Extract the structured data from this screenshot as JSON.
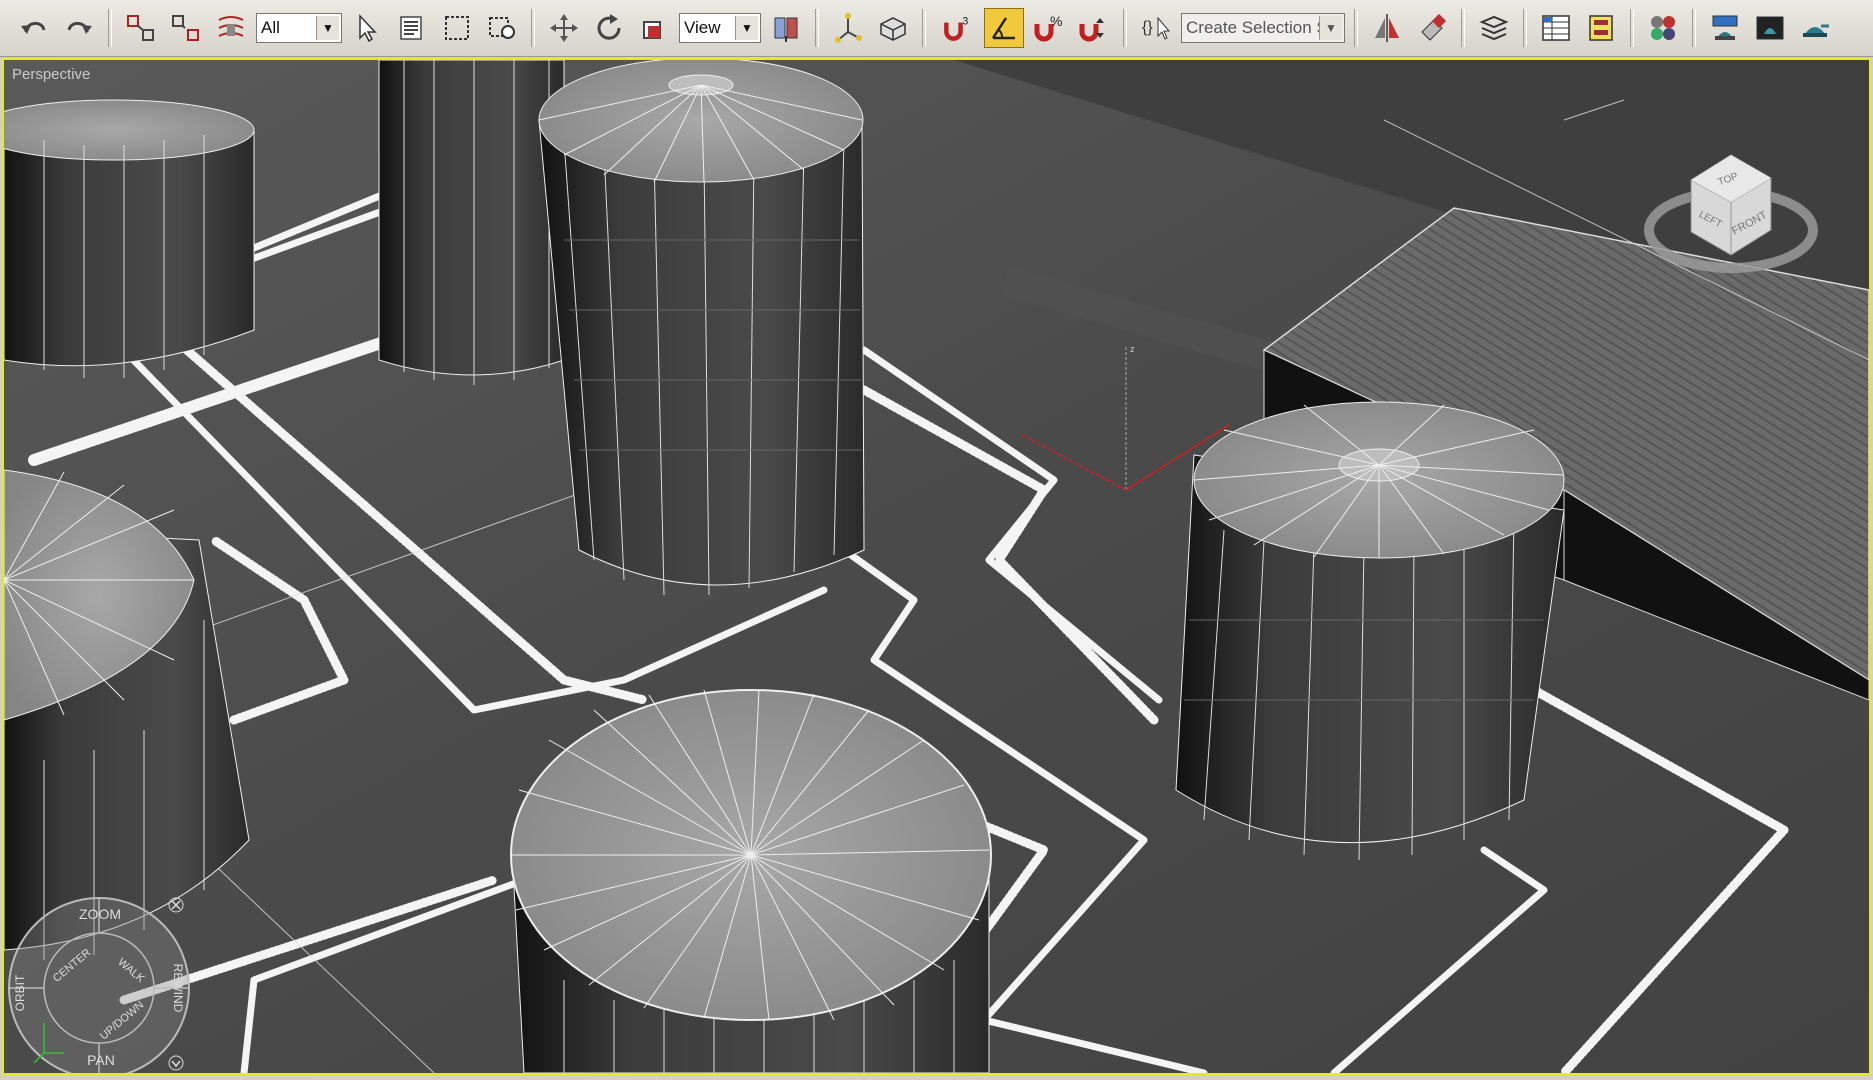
{
  "toolbar": {
    "selection_filter": "All",
    "reference_coordinate": "View",
    "snap_value": "3",
    "angle_snap_active": true,
    "named_selection_placeholder": "Create Selection Set"
  },
  "viewport": {
    "label": "Perspective",
    "border_color": "#e8e82a"
  },
  "viewcube": {
    "top": "TOP",
    "left": "LEFT",
    "front": "FRONT"
  },
  "steering_wheel": {
    "zoom": "ZOOM",
    "orbit": "ORBIT",
    "center": "CENTER",
    "walk": "WALK",
    "rewind": "REWIND",
    "up_down": "UP/DOWN",
    "pan": "PAN"
  },
  "colors": {
    "active_tool": "#f1c93c",
    "ground": "#4c4c4c",
    "tank_body": "#3a3a3a",
    "tank_top": "#9a9a9a",
    "wire": "#ffffff",
    "axis_x": "#d02020"
  }
}
